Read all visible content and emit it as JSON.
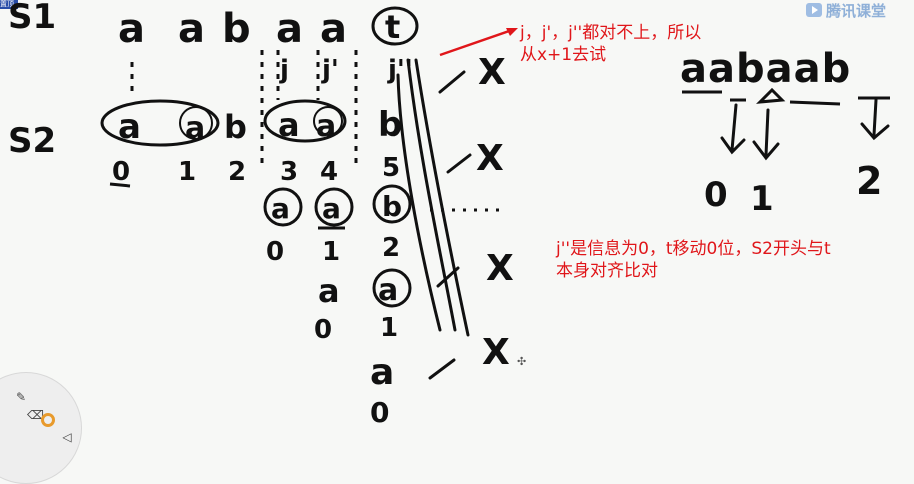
{
  "app": {
    "logo_text": "腾讯课堂",
    "logo_icon": "play-icon",
    "corner_tag_text": "置顶"
  },
  "annotations": {
    "top_note_line1": "j，j'，j''都对不上，所以",
    "top_note_line2": "从x+1去试",
    "bottom_note_line1": "j''是信息为0，t移动0位，S2开头与t",
    "bottom_note_line2": "本身对齐比对"
  },
  "handwriting": {
    "s1_label": "S1",
    "s1_chars": [
      "a",
      "a",
      "b",
      "a",
      "a",
      "t"
    ],
    "s2_label": "S2",
    "s2_chars": [
      "a",
      "a",
      "b",
      "a",
      "a",
      "b"
    ],
    "s2_indices": [
      "0",
      "1",
      "2",
      "3",
      "4",
      "5"
    ],
    "j_marks": [
      "j",
      "j'",
      "j''"
    ],
    "shift1_chars": [
      "a",
      "a",
      "b"
    ],
    "shift1_indices": [
      "0",
      "1",
      "2"
    ],
    "shift2_chars": [
      "a",
      "a"
    ],
    "shift2_indices": [
      "0",
      "1"
    ],
    "shift3_chars": [
      "a"
    ],
    "shift3_indices": [
      "0"
    ],
    "cross_mark": "X",
    "right_example_string": "aabaab",
    "right_example_values": [
      "0",
      "1",
      "2"
    ]
  },
  "toolbar": {
    "tools": [
      "pen-icon",
      "eraser-icon",
      "color-wheel-icon",
      "arrow-icon"
    ]
  },
  "colors": {
    "annotation": "#e0161a",
    "ink": "#111111",
    "background": "#f7f8f6"
  }
}
